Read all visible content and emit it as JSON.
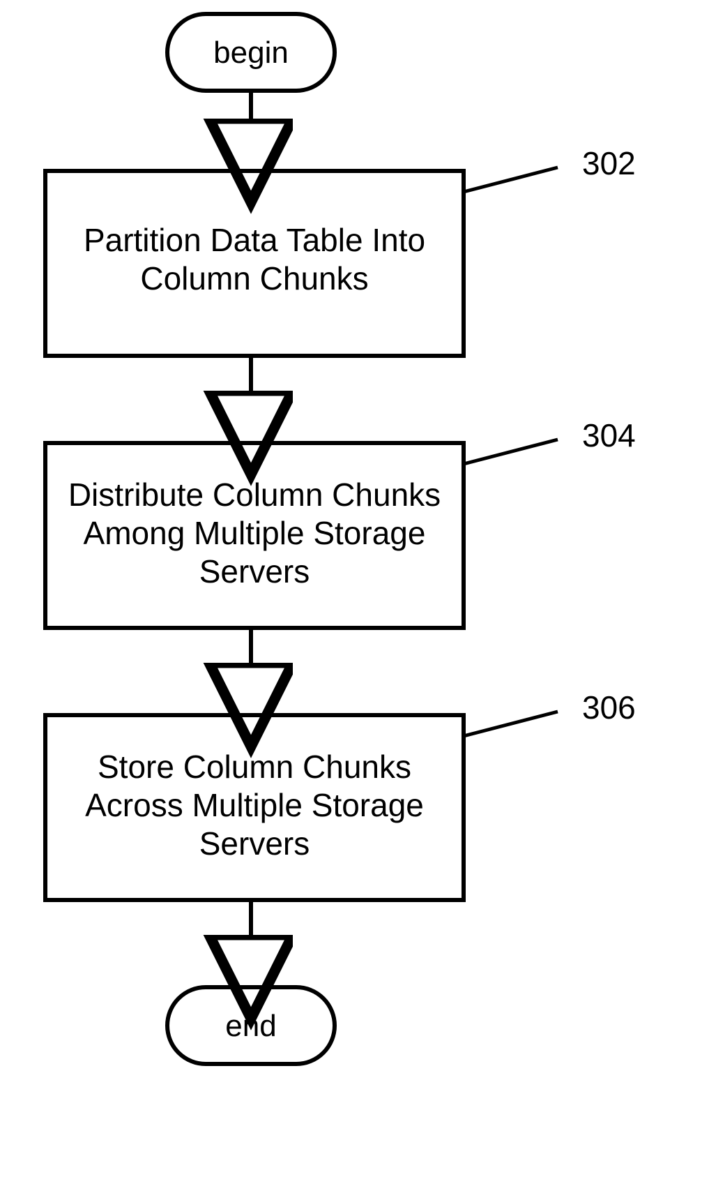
{
  "chart_data": {
    "type": "flowchart",
    "nodes": [
      {
        "id": "begin",
        "type": "terminator",
        "label": "begin"
      },
      {
        "id": "302",
        "type": "process",
        "ref": "302",
        "label": "Partition Data Table Into Column Chunks"
      },
      {
        "id": "304",
        "type": "process",
        "ref": "304",
        "label": "Distribute Column Chunks Among Multiple Storage Servers"
      },
      {
        "id": "306",
        "type": "process",
        "ref": "306",
        "label": "Store Column Chunks Across Multiple Storage Servers"
      },
      {
        "id": "end",
        "type": "terminator",
        "label": "end"
      }
    ],
    "edges": [
      {
        "from": "begin",
        "to": "302"
      },
      {
        "from": "302",
        "to": "304"
      },
      {
        "from": "304",
        "to": "306"
      },
      {
        "from": "306",
        "to": "end"
      }
    ]
  },
  "terminators": {
    "begin": "begin",
    "end": "end"
  },
  "steps": {
    "s302": {
      "ref": "302",
      "line1": "Partition Data Table Into",
      "line2": "Column Chunks"
    },
    "s304": {
      "ref": "304",
      "line1": "Distribute Column Chunks",
      "line2": "Among Multiple Storage",
      "line3": "Servers"
    },
    "s306": {
      "ref": "306",
      "line1": "Store Column Chunks",
      "line2": "Across Multiple Storage",
      "line3": "Servers"
    }
  }
}
